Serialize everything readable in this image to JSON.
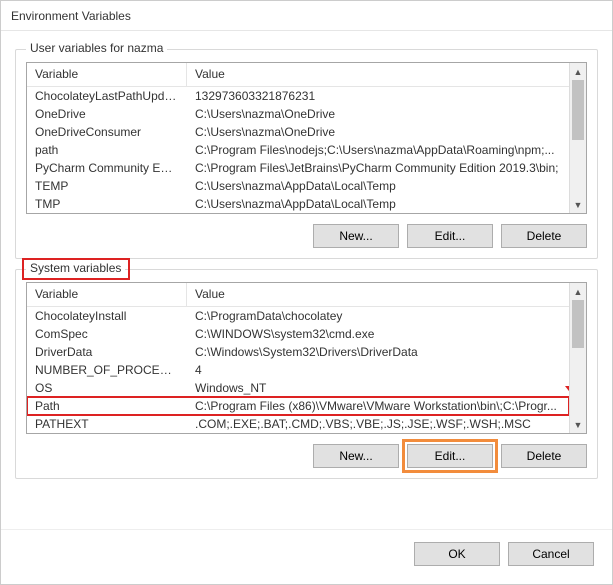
{
  "title": "Environment Variables",
  "user_section": {
    "legend": "User variables for nazma",
    "columns": {
      "var": "Variable",
      "val": "Value"
    },
    "rows": [
      {
        "var": "ChocolateyLastPathUpdate",
        "val": "132973603321876231"
      },
      {
        "var": "OneDrive",
        "val": "C:\\Users\\nazma\\OneDrive"
      },
      {
        "var": "OneDriveConsumer",
        "val": "C:\\Users\\nazma\\OneDrive"
      },
      {
        "var": "path",
        "val": "C:\\Program Files\\nodejs;C:\\Users\\nazma\\AppData\\Roaming\\npm;..."
      },
      {
        "var": "PyCharm Community Edition",
        "val": "C:\\Program Files\\JetBrains\\PyCharm Community Edition 2019.3\\bin;"
      },
      {
        "var": "TEMP",
        "val": "C:\\Users\\nazma\\AppData\\Local\\Temp"
      },
      {
        "var": "TMP",
        "val": "C:\\Users\\nazma\\AppData\\Local\\Temp"
      }
    ],
    "buttons": {
      "new": "New...",
      "edit": "Edit...",
      "delete": "Delete"
    }
  },
  "system_section": {
    "legend": "System variables",
    "columns": {
      "var": "Variable",
      "val": "Value"
    },
    "rows": [
      {
        "var": "ChocolateyInstall",
        "val": "C:\\ProgramData\\chocolatey"
      },
      {
        "var": "ComSpec",
        "val": "C:\\WINDOWS\\system32\\cmd.exe"
      },
      {
        "var": "DriverData",
        "val": "C:\\Windows\\System32\\Drivers\\DriverData"
      },
      {
        "var": "NUMBER_OF_PROCESSORS",
        "val": "4"
      },
      {
        "var": "OS",
        "val": "Windows_NT"
      },
      {
        "var": "Path",
        "val": "C:\\Program Files (x86)\\VMware\\VMware Workstation\\bin\\;C:\\Progr..."
      },
      {
        "var": "PATHEXT",
        "val": ".COM;.EXE;.BAT;.CMD;.VBS;.VBE;.JS;.JSE;.WSF;.WSH;.MSC"
      }
    ],
    "selected_index": 5,
    "buttons": {
      "new": "New...",
      "edit": "Edit...",
      "delete": "Delete"
    }
  },
  "footer": {
    "ok": "OK",
    "cancel": "Cancel"
  }
}
